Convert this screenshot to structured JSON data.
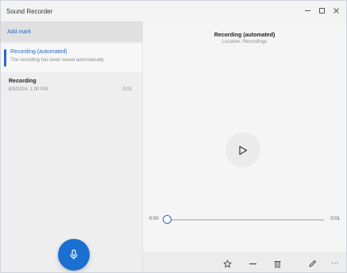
{
  "window": {
    "title": "Sound Recorder",
    "controls": [
      "minimize-icon",
      "maximize-icon",
      "close-icon"
    ]
  },
  "sidebar": {
    "add_item_label": "Add mark",
    "items": [
      {
        "name": "Recording (automated)",
        "detail": "The recording has been saved automatically",
        "selected": true
      },
      {
        "name": "Recording",
        "date": "8/5/2024, 1:00 PM",
        "duration": "0:01",
        "selected": false
      }
    ],
    "record_button_icon": "microphone-icon"
  },
  "player": {
    "title": "Recording (automated)",
    "subtitle": "Location: Recordings",
    "play_icon": "play-icon",
    "time_current": "0:00",
    "time_total": "0:01",
    "progress": 0.0
  },
  "toolbar": {
    "icons": [
      "star-icon",
      "trim-icon",
      "delete-icon",
      "edit-icon",
      "more-icon"
    ],
    "more_label": "···"
  },
  "colors": {
    "accent": "#2b66c5",
    "record_button": "#1a6fd0"
  }
}
